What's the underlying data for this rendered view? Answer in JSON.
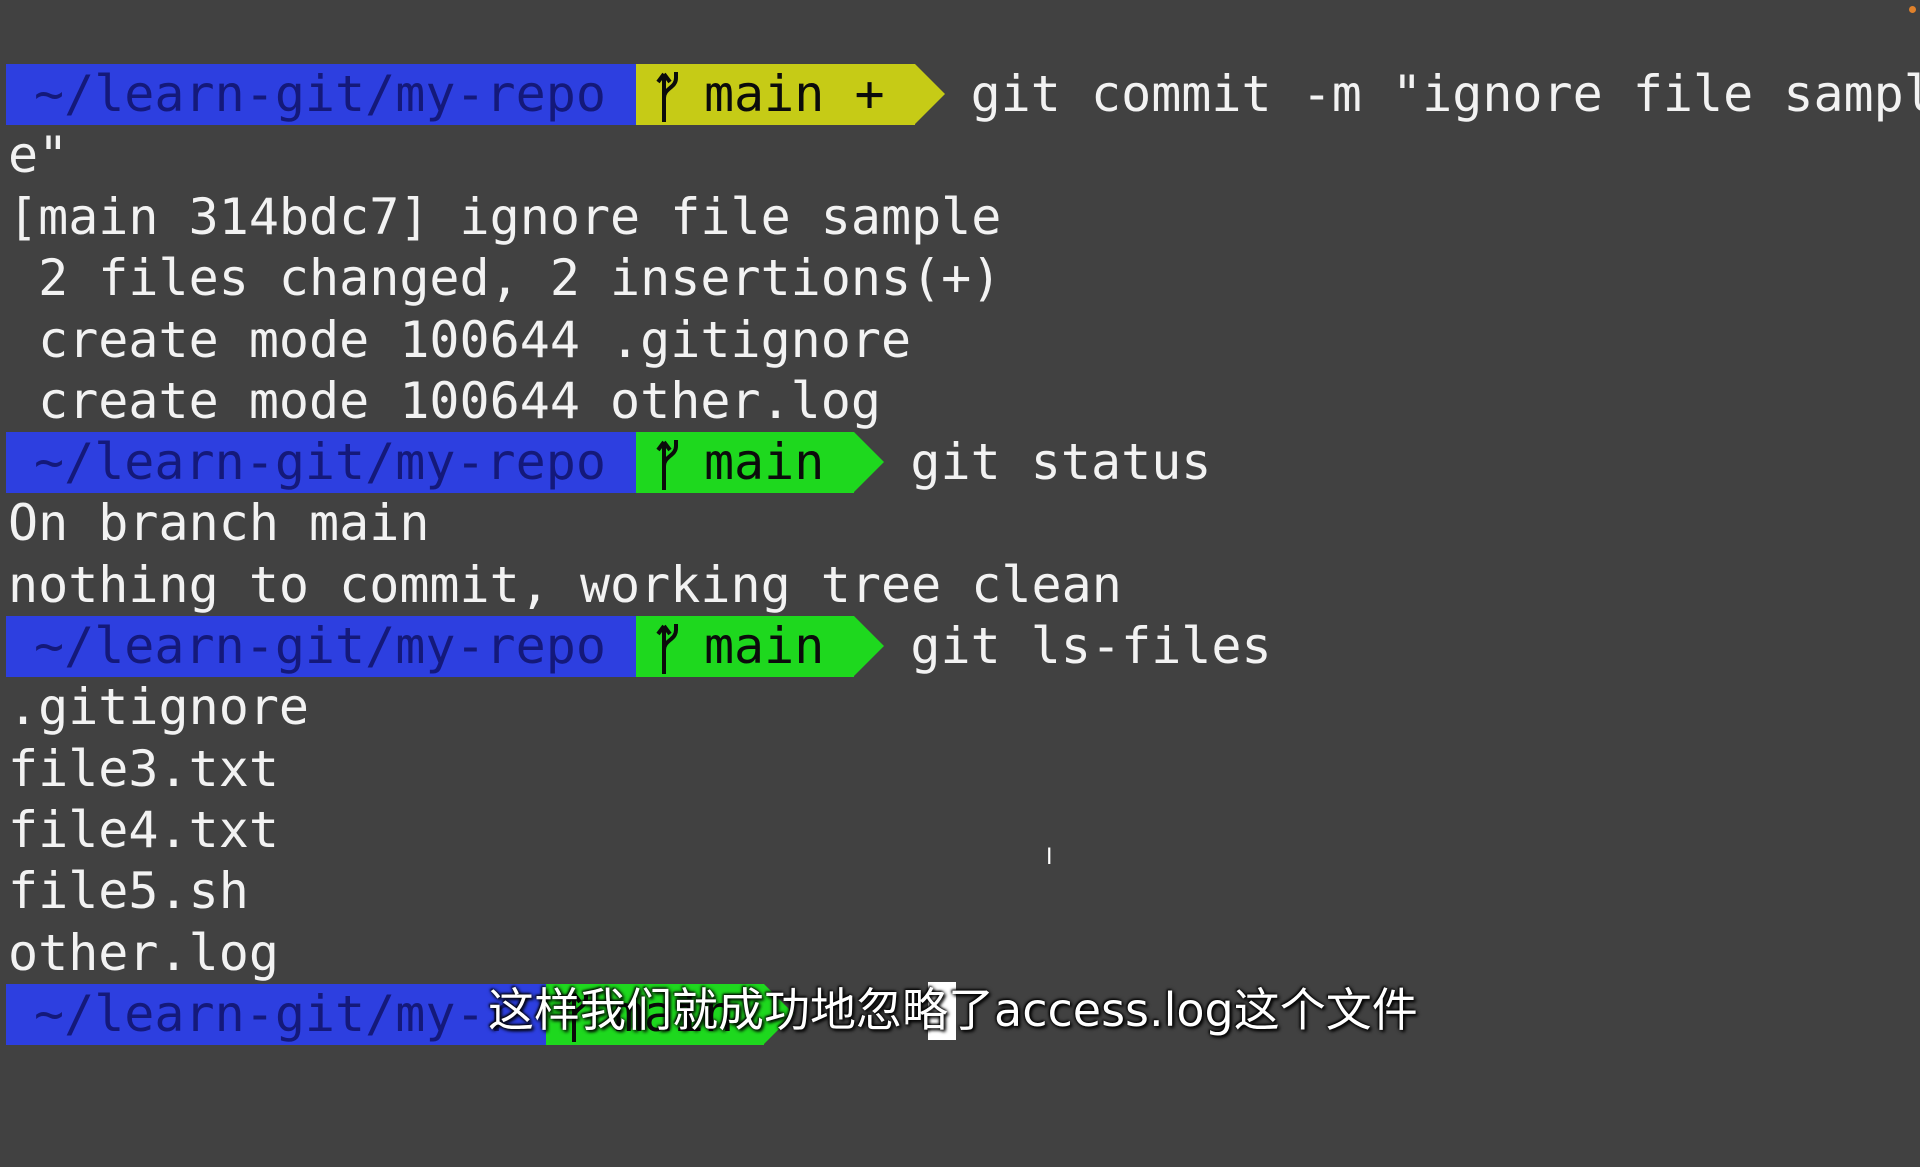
{
  "prompts": [
    {
      "path": "~/learn-git/my-repo",
      "branch": "main +",
      "command": "git commit -m \"ignore file sampl"
    },
    {
      "path": "~/learn-git/my-repo",
      "branch": "main",
      "command": "git status"
    },
    {
      "path": "~/learn-git/my-repo",
      "branch": "main",
      "command": "git ls-files"
    },
    {
      "path": "~/learn-git/my-r",
      "branch": "main",
      "command": ""
    }
  ],
  "output": {
    "commit_wrap": "e\"",
    "commit_lines": [
      "[main 314bdc7] ignore file sample",
      " 2 files changed, 2 insertions(+)",
      " create mode 100644 .gitignore",
      " create mode 100644 other.log"
    ],
    "status_lines": [
      "On branch main",
      "nothing to commit, working tree clean"
    ],
    "ls_files": [
      ".gitignore",
      "file3.txt",
      "file4.txt",
      "file5.sh",
      "other.log"
    ]
  },
  "subtitle": "这样我们就成功地忽略了access.log这个文件",
  "colors": {
    "background": "#414141",
    "path_segment": "#2d3fe0",
    "branch_dirty": "#c6cb16",
    "branch_clean": "#1ed81e"
  },
  "icons": {
    "branch": "git-branch-icon",
    "cursor": "ibeam-cursor-icon"
  }
}
